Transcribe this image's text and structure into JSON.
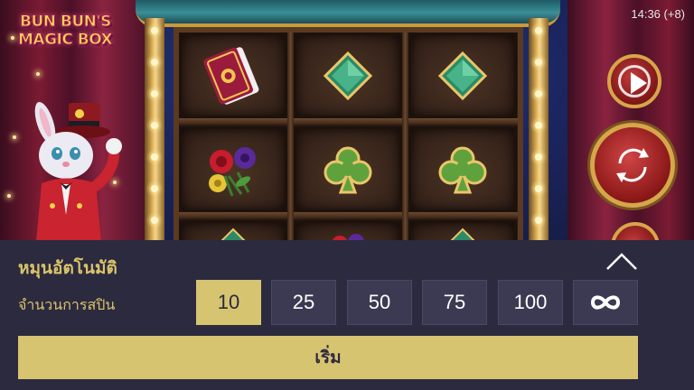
{
  "status_bar": {
    "time": "14:36 (+8)"
  },
  "game": {
    "logo_line1": "BUN BUN'S",
    "logo_line2": "MAGIC BOX",
    "reels": [
      [
        "magic-book-icon",
        "flowers-icon",
        "diamond-icon"
      ],
      [
        "diamond-icon",
        "club-icon",
        "flowers-icon"
      ],
      [
        "diamond-icon",
        "club-icon",
        "diamond-icon"
      ]
    ],
    "colors": {
      "accent": "#d7c471",
      "panel": "#2c2a3f",
      "button": "#3c3a52"
    }
  },
  "autoplay_panel": {
    "title": "หมุนอัตโนมัติ",
    "spins_label": "จำนวนการสปิน",
    "options": [
      {
        "label": "10",
        "selected": true
      },
      {
        "label": "25",
        "selected": false
      },
      {
        "label": "50",
        "selected": false
      },
      {
        "label": "75",
        "selected": false
      },
      {
        "label": "100",
        "selected": false
      },
      {
        "label": "",
        "icon": "infinity-icon",
        "selected": false
      }
    ],
    "start_label": "เริ่ม",
    "collapse_icon": "chevron-up-icon"
  }
}
